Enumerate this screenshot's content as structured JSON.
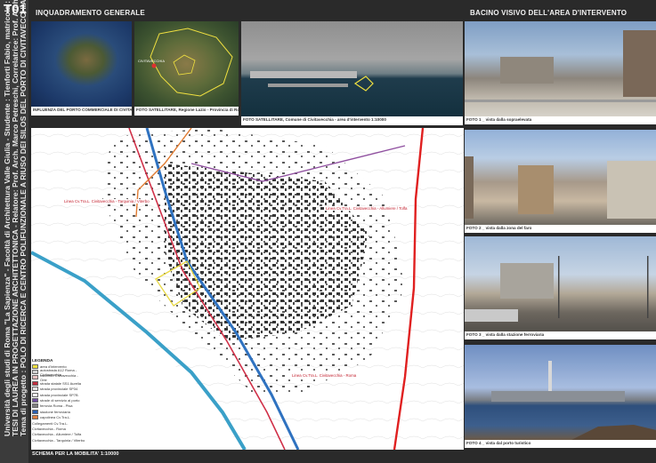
{
  "board": {
    "code": "T01",
    "side_text": [
      "Università degli studi di Roma \"La Sapienza\" - Facoltà di Architettura Valle Giulia - Studente : Tienforti Fabio, matricola : 41077683",
      "TESI DI LAUREA IN PROGETTAZIONE ARCHITETTONICA - Relatore: Prof. Arch. Marco Petreschi, Correlatrice: Prof. Arch. Nilda Valentin",
      "Tema di progetto : POLO DI RICERCA E CENTRO POLIFUNZIONALE A RIUSO DEI SILOS DEL PORTO DI CIVITAVECCHIA"
    ]
  },
  "headers": {
    "left": "INQUADRAMENTO GENERALE",
    "right": "BACINO VISIVO DELL'AREA D'INTERVENTO"
  },
  "top_images": [
    {
      "caption": "INFLUENZA DEL PORTO COMMERCIALE DI CIVITAVECCHIA"
    },
    {
      "caption": "FOTO SATELLITARE, Regione Lazio - Provincia di Roma",
      "place_label": "CIVITAVECCHIA"
    },
    {
      "caption": "FOTO SATELLITARE, Comune di Civitavecchia - area d'intervento 1:10000"
    }
  ],
  "photos": [
    {
      "caption": "FOTO 1 _ vista dalla sopraelevata"
    },
    {
      "caption": "FOTO 2 _ vista dalla zona del faro"
    },
    {
      "caption": "FOTO 3 _ vista dalla stazione ferroviaria"
    },
    {
      "caption": "FOTO 4 _ vista dal porto turistico"
    }
  ],
  "map": {
    "labels": [
      "Linea Cv.Tra.L. Civitavecchia - Tarquinia / Viterbo",
      "Linea Cv.Tra.L. Civitavecchia - Allumiere / Tolfa",
      "Linea Cv.Tra.L. Civitavecchia - Roma"
    ],
    "legend_title": "LEGENDA",
    "legend": [
      {
        "label": "area d'intervento",
        "color": "#f0e040"
      },
      {
        "label": "autostrada A12 Roma - Civitavecchia",
        "color": "#d0d0d0"
      },
      {
        "label": "raccordo Civitavecchia - Orte",
        "color": "#e8c0c0"
      },
      {
        "label": "strada statale SS1 Aurelia",
        "color": "#c03040"
      },
      {
        "label": "strada provinciale SP34",
        "color": "#e6e6e6"
      },
      {
        "label": "strada provinciale SP7B",
        "color": "#f0f0f0"
      },
      {
        "label": "strade di servizio al porto",
        "color": "#7050a0"
      },
      {
        "label": "ferrovia Roma - Pisa",
        "color": "#808080"
      },
      {
        "label": "stazione ferroviaria",
        "color": "#2a5fb0"
      },
      {
        "label": "capolinea Cv.Tra.L.",
        "color": "#e08040"
      }
    ],
    "legend_footer": [
      "Collegamenti Cv.Tra.L.",
      "Civitavecchia - Roma",
      "Civitavecchia - Allumiere / Tolfa",
      "Civitavecchia - Tarquinia / Viterbo"
    ],
    "schema_title": "SCHEMA PER LA MOBILITA' 1:10000",
    "colors": {
      "water": "#3aa0c8",
      "river": "#2f72c0",
      "aurelia": "#d03048",
      "bus": "#e07a30",
      "rail": "#9050a0",
      "highway": "#e02020"
    }
  }
}
